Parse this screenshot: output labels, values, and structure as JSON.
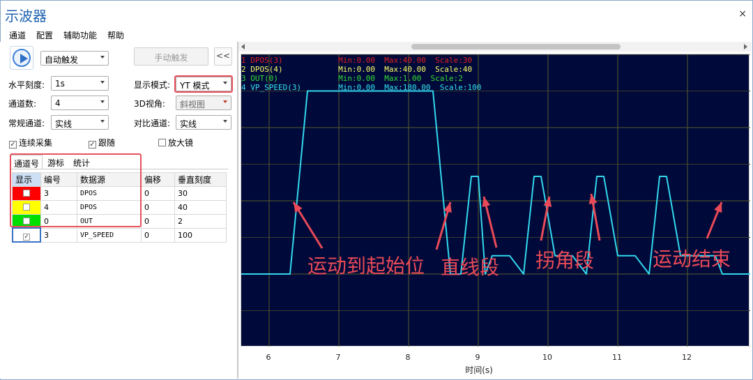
{
  "window": {
    "title": "示波器",
    "close_glyph": "×"
  },
  "menu": [
    "通道",
    "配置",
    "辅助功能",
    "帮助"
  ],
  "controls": {
    "trigger_mode": "自动触发",
    "manual_trigger": "手动触发",
    "collapse": "<<",
    "h_scale_label": "水平刻度:",
    "h_scale_value": "1s",
    "display_mode_label": "显示模式:",
    "display_mode_value": "YT 模式",
    "channels_label": "通道数:",
    "channels_value": "4",
    "view3d_label": "3D视角:",
    "view3d_value": "斜视图",
    "normal_channel_label": "常规通道:",
    "normal_channel_value": "实线",
    "compare_channel_label": "对比通道:",
    "compare_channel_value": "实线",
    "continuous": "连续采集",
    "follow": "跟随",
    "magnifier": "放大镜",
    "continuous_checked": true,
    "follow_checked": true,
    "magnifier_checked": false,
    "check_glyph": "☑"
  },
  "tabs": [
    "通道号",
    "游标",
    "统计"
  ],
  "table": {
    "headers": [
      "显示",
      "编号",
      "数据源",
      "偏移",
      "垂直刻度"
    ],
    "rows": [
      {
        "color": "#ff0000",
        "checked": false,
        "num": "3",
        "source": "DPOS",
        "offset": "0",
        "scale": "30"
      },
      {
        "color": "#ffff00",
        "checked": false,
        "num": "4",
        "source": "DPOS",
        "offset": "0",
        "scale": "40"
      },
      {
        "color": "#00dd00",
        "checked": false,
        "num": "0",
        "source": "OUT",
        "offset": "0",
        "scale": "2"
      },
      {
        "color": "#ffffff",
        "checked": true,
        "num": "3",
        "source": "VP_SPEED",
        "offset": "0",
        "scale": "100"
      }
    ]
  },
  "legend": [
    {
      "text": "1 DPOS(3)            Min:0.00  Max:40.00  Scale:30",
      "color": "#e02020"
    },
    {
      "text": "2 DPOS(4)            Min:0.00  Max:40.00  Scale:40",
      "color": "#ffff66"
    },
    {
      "text": "3 OUT(0)             Min:0.00  Max:1.00  Scale:2",
      "color": "#33dd33"
    },
    {
      "text": "4 VP_SPEED(3)        Min:0.00  Max:180.00  Scale:100",
      "color": "#33e0f0"
    }
  ],
  "chart_data": {
    "type": "line",
    "xlabel": "时间(s)",
    "xticks": [
      "6",
      "7",
      "8",
      "9",
      "10",
      "11",
      "12"
    ],
    "xlim": [
      5.6,
      12.9
    ],
    "ylim": [
      -60,
      180
    ],
    "grid": true,
    "series": [
      {
        "name": "VP_SPEED(3)",
        "color": "#33d8ee",
        "x": [
          5.6,
          6.3,
          6.55,
          8.35,
          8.5,
          8.6,
          8.75,
          8.9,
          9.0,
          9.1,
          9.2,
          9.45,
          9.65,
          9.8,
          9.9,
          10.1,
          10.35,
          10.55,
          10.7,
          10.8,
          11.0,
          11.25,
          11.45,
          11.6,
          11.7,
          11.9,
          12.4,
          12.5,
          12.9
        ],
        "y": [
          0,
          0,
          150,
          150,
          60,
          0,
          0,
          80,
          80,
          0,
          15,
          15,
          0,
          80,
          80,
          15,
          15,
          0,
          80,
          80,
          15,
          15,
          0,
          80,
          80,
          15,
          15,
          0,
          0
        ]
      }
    ]
  },
  "annotations": [
    "运动到起始位",
    "直线段",
    "拐角段",
    "运动结束"
  ]
}
